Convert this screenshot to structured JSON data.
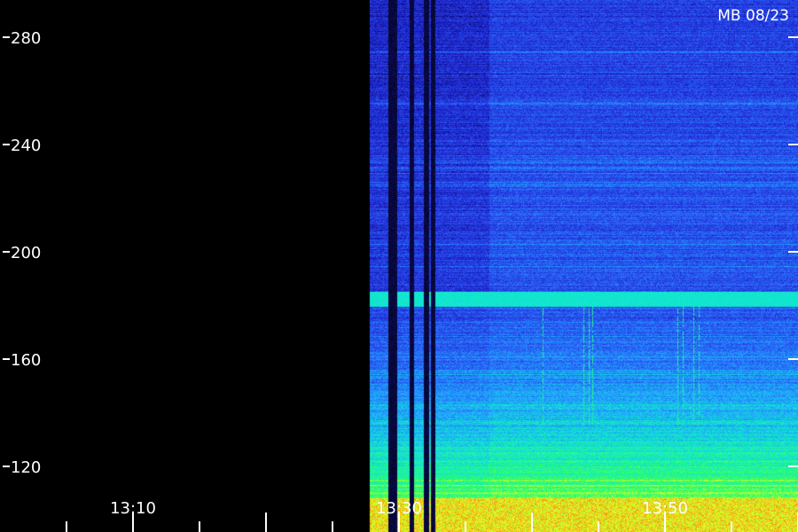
{
  "badge": "MB 08/23",
  "chart_data": {
    "type": "heatmap",
    "title": "",
    "xlabel": "",
    "ylabel": "",
    "y_ticks": [
      280,
      240,
      200,
      160,
      120
    ],
    "ylim": [
      103,
      293
    ],
    "x_ticks": [
      "13:10",
      "13:30",
      "13:50"
    ],
    "xlim": [
      "13:00",
      "13:60"
    ],
    "data_start": "13:27.8",
    "colormap": [
      "#000000",
      "#1a1ac0",
      "#2a50f0",
      "#20a0ff",
      "#10e8d0",
      "#30ff60",
      "#e8ff20",
      "#ff6010"
    ],
    "features": [
      {
        "name": "",
        "band_y": [
          180,
          185
        ],
        "level": "cyan"
      },
      {
        "name": "",
        "band_y": [
          103,
          108
        ],
        "level": "yellow-red"
      }
    ]
  }
}
